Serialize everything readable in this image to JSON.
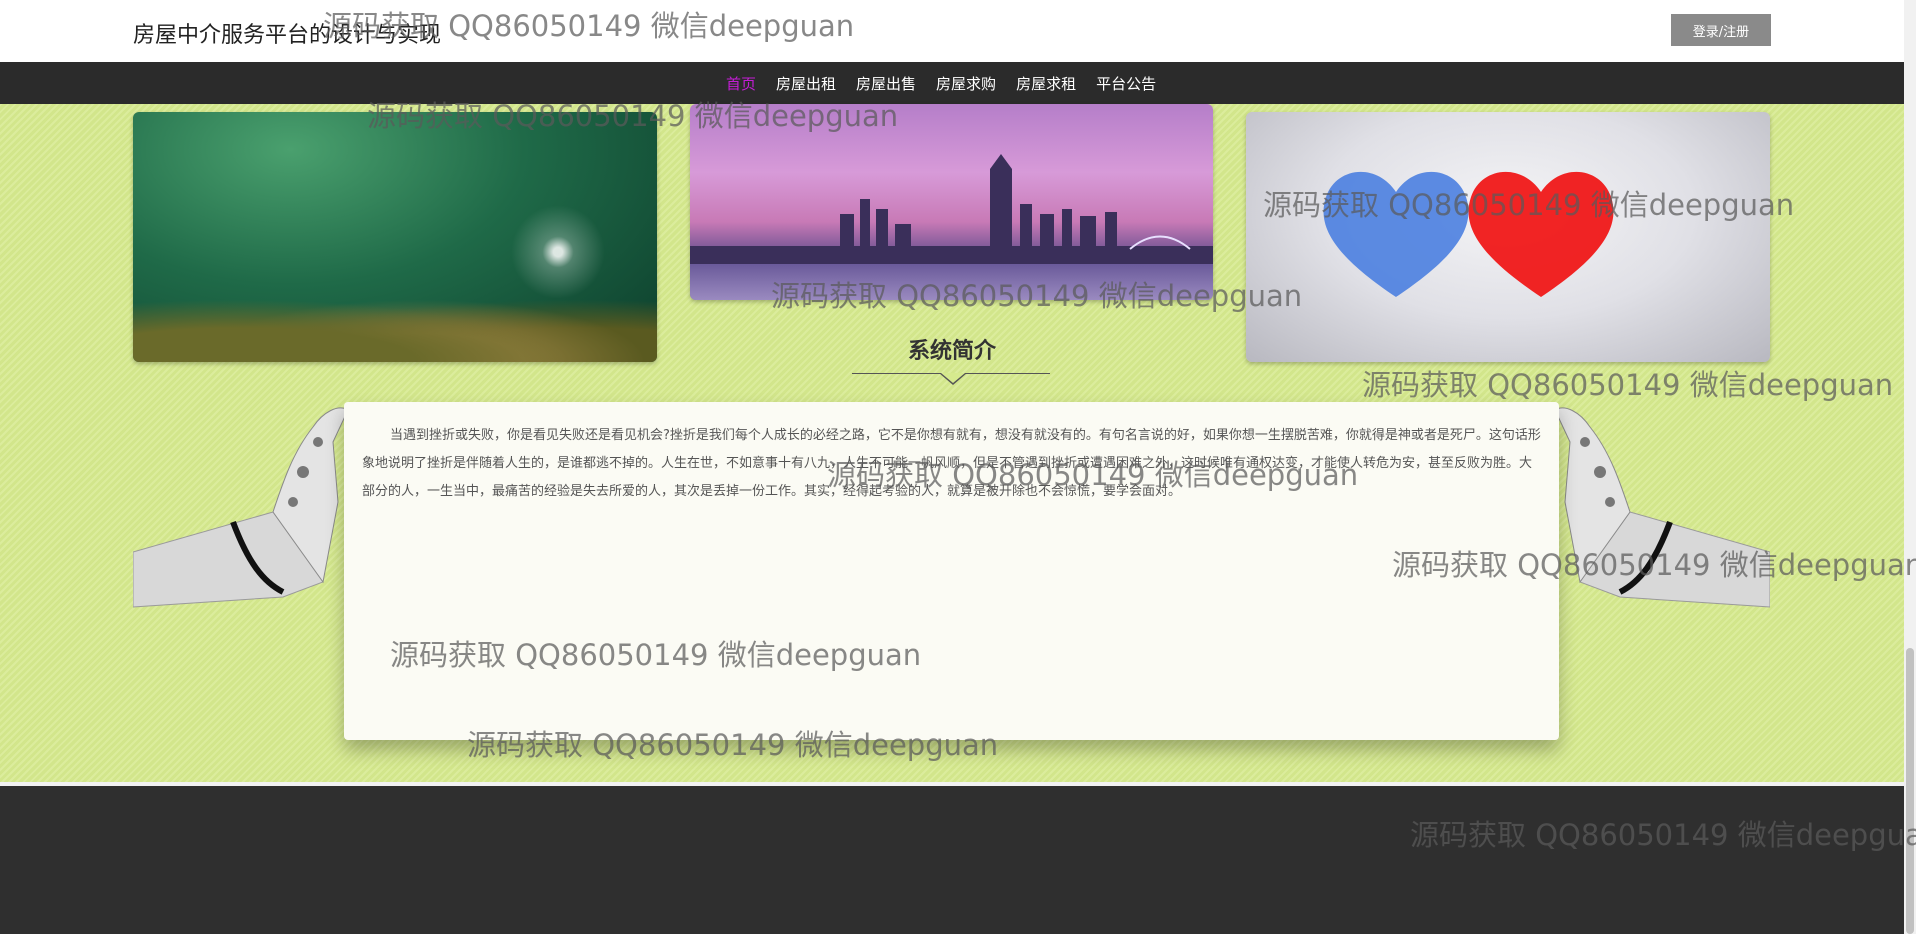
{
  "header": {
    "site_title": "房屋中介服务平台的设计与实现",
    "login_label": "登录/注册"
  },
  "nav": {
    "items": [
      {
        "label": "首页",
        "active": true
      },
      {
        "label": "房屋出租",
        "active": false
      },
      {
        "label": "房屋出售",
        "active": false
      },
      {
        "label": "房屋求购",
        "active": false
      },
      {
        "label": "房屋求租",
        "active": false
      },
      {
        "label": "平台公告",
        "active": false
      }
    ]
  },
  "section": {
    "title": "系统简介",
    "intro": "当遇到挫折或失败，你是看见失败还是看见机会?挫折是我们每个人成长的必经之路，它不是你想有就有，想没有就没有的。有句名言说的好，如果你想一生摆脱苦难，你就得是神或者是死尸。这句话形象地说明了挫折是伴随着人生的，是谁都逃不掉的。人生在世，不如意事十有八九，人生不可能一帆风顺，但是不管遇到挫折或遭遇困难之外，这时候唯有通权达变，才能使人转危为安，甚至反败为胜。大部分的人，一生当中，最痛苦的经验是失去所爱的人，其次是丢掉一份工作。其实，经得起考验的人，就算是被开除也不会惊慌，要学会面对。"
  },
  "watermark": {
    "text": "源码获取 QQ86050149 微信deepguan"
  },
  "colors": {
    "nav_active": "#c41dd6",
    "main_bg": "#d6ea8e",
    "navbar_bg": "#2b2b2b",
    "footer_bg": "#2f2f2f"
  },
  "icons": {
    "hand_left": "robot-hand-left-icon",
    "hand_right": "robot-hand-right-icon"
  }
}
